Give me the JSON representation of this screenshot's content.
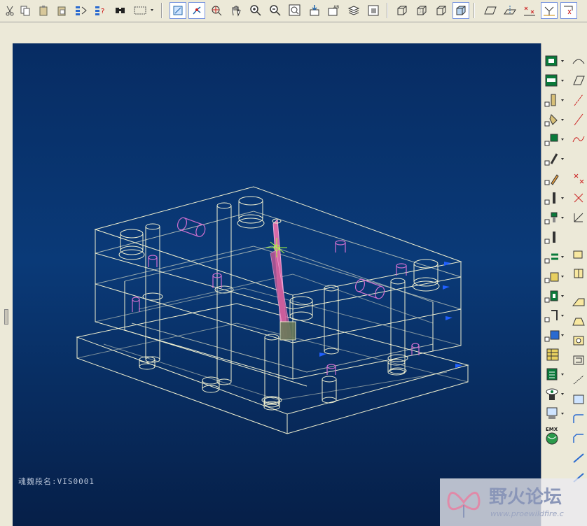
{
  "viewport": {
    "status_label": "魂魏段名:VIS0001"
  },
  "watermark": {
    "title": "野火论坛",
    "url": "www.proewildfire.c"
  },
  "colors": {
    "wire": "#f0f0d0",
    "pin": "#d070d0",
    "core": "#d86aa8",
    "highlight": "#a8ff40"
  }
}
